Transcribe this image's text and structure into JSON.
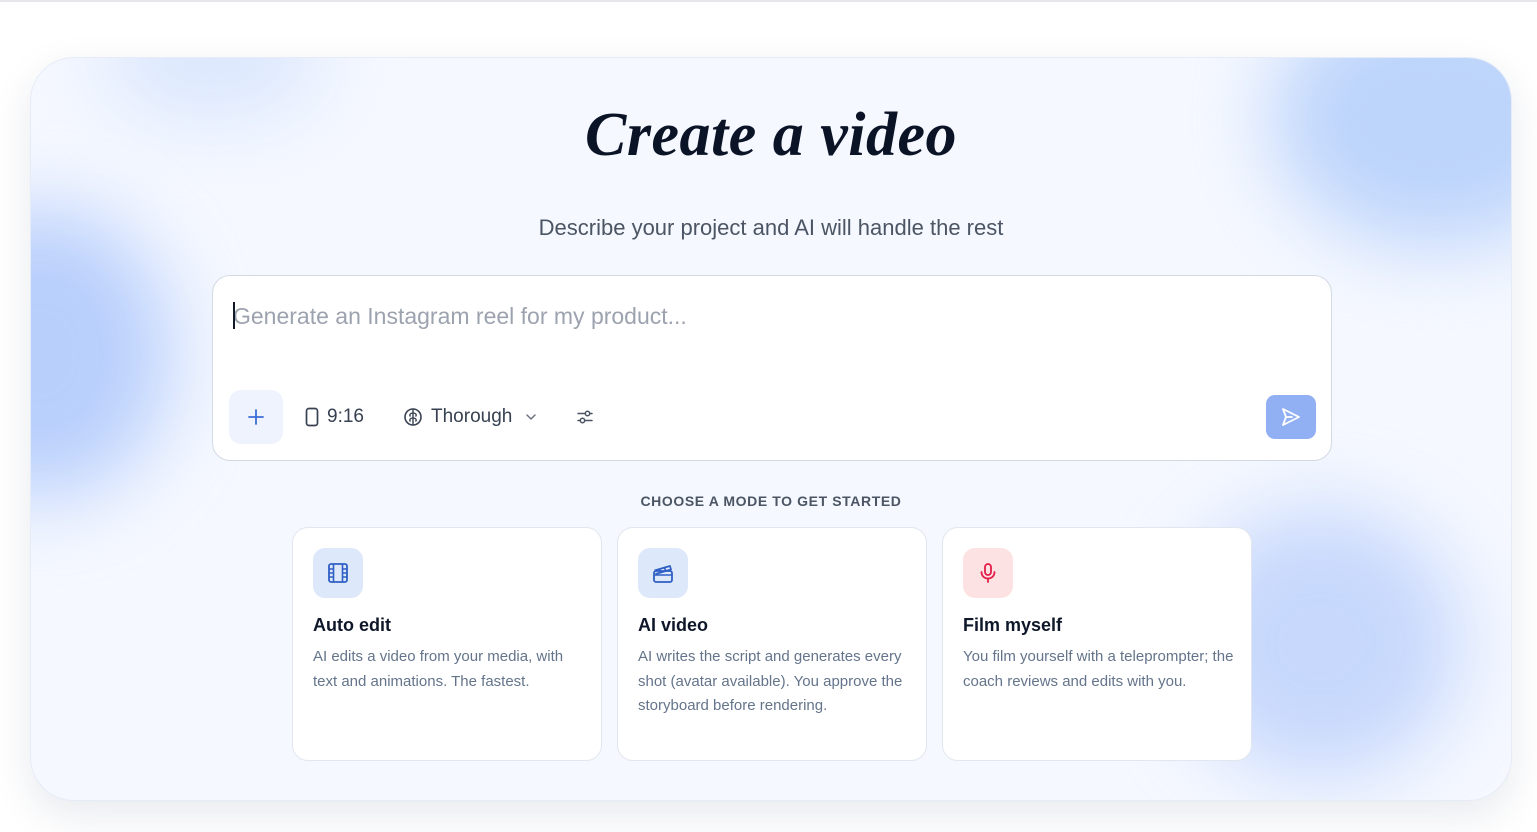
{
  "header": {
    "title": "Create a video",
    "subtitle": "Describe your project and AI will handle the rest"
  },
  "composer": {
    "placeholder": "Generate an Instagram reel for my product...",
    "value": "",
    "add_icon": "plus-icon",
    "aspect_ratio": "9:16",
    "aspect_icon": "phone-portrait-icon",
    "mode": "Thorough",
    "mode_icon": "brain-icon",
    "settings_icon": "sliders-icon",
    "send_icon": "send-icon"
  },
  "modes": {
    "label": "CHOOSE A MODE TO GET STARTED",
    "items": [
      {
        "title": "Auto edit",
        "description": "AI edits a video from your media, with text and animations. The fastest.",
        "icon": "film-icon"
      },
      {
        "title": "AI video",
        "description": "AI writes the script and generates every shot (avatar available). You approve the storyboard before rendering.",
        "icon": "clapperboard-icon"
      },
      {
        "title": "Film myself",
        "description": "You film yourself with a teleprompter; the coach reviews and edits with you.",
        "icon": "microphone-icon"
      }
    ]
  },
  "colors": {
    "accent": "#3b6fd4",
    "send_button": "#91b0f4",
    "panel_background": "#f5f8ff",
    "mic_icon": "#e11d48"
  }
}
